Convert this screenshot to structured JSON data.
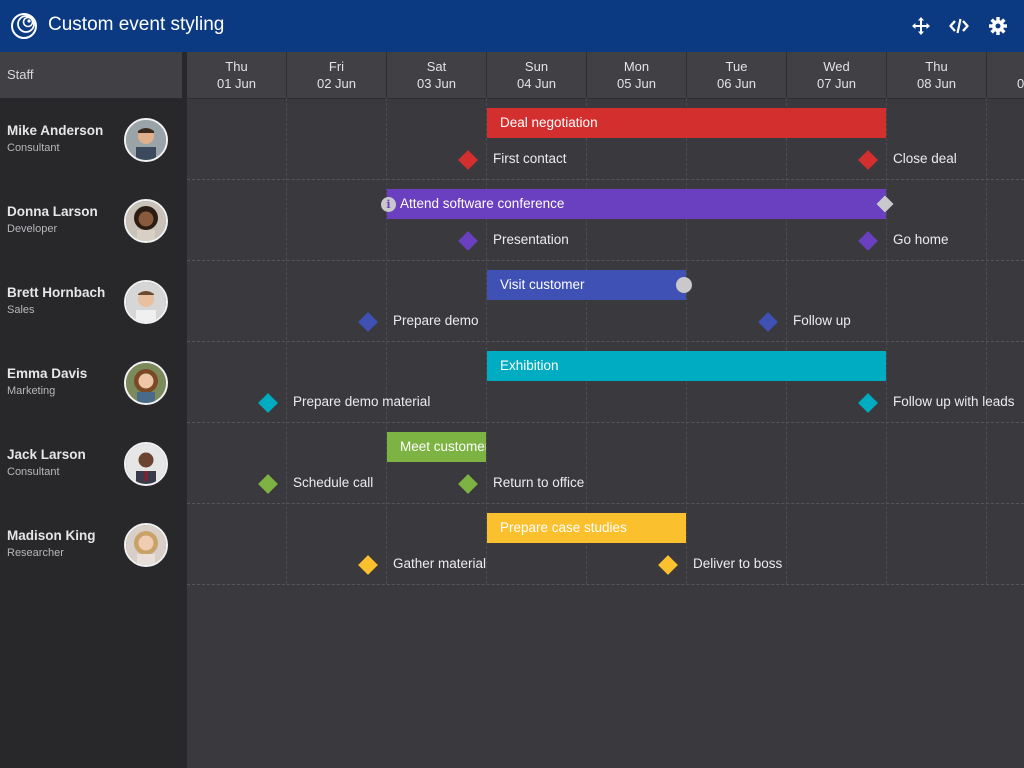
{
  "app": {
    "title": "Custom event styling"
  },
  "header_icons": [
    "move-icon",
    "code-icon",
    "gear-icon"
  ],
  "sidebar": {
    "header": "Staff"
  },
  "days": [
    {
      "name": "Thu",
      "date": "01 Jun"
    },
    {
      "name": "Fri",
      "date": "02 Jun"
    },
    {
      "name": "Sat",
      "date": "03 Jun"
    },
    {
      "name": "Sun",
      "date": "04 Jun"
    },
    {
      "name": "Mon",
      "date": "05 Jun"
    },
    {
      "name": "Tue",
      "date": "06 Jun"
    },
    {
      "name": "Wed",
      "date": "07 Jun"
    },
    {
      "name": "Thu",
      "date": "08 Jun"
    },
    {
      "name": "",
      "date": "0"
    }
  ],
  "resources": [
    {
      "name": "Mike Anderson",
      "title": "Consultant"
    },
    {
      "name": "Donna Larson",
      "title": "Developer"
    },
    {
      "name": "Brett Hornbach",
      "title": "Sales"
    },
    {
      "name": "Emma Davis",
      "title": "Marketing"
    },
    {
      "name": "Jack Larson",
      "title": "Consultant"
    },
    {
      "name": "Madison King",
      "title": "Researcher"
    }
  ],
  "events": [
    {
      "label": "Deal negotiation",
      "color": "#d32f2f"
    },
    {
      "label": "Attend software conference",
      "color": "#6a3fc0"
    },
    {
      "label": "Visit customer",
      "color": "#3f51b5"
    },
    {
      "label": "Exhibition",
      "color": "#00acc1"
    },
    {
      "label": "Meet customer",
      "color": "#7cb342"
    },
    {
      "label": "Prepare case studies",
      "color": "#fbc02d"
    }
  ],
  "milestones": [
    {
      "label": "First contact",
      "color": "#d32f2f"
    },
    {
      "label": "Close deal",
      "color": "#d32f2f"
    },
    {
      "label": "Presentation",
      "color": "#6a3fc0"
    },
    {
      "label": "Go home",
      "color": "#6a3fc0"
    },
    {
      "label": "Prepare demo",
      "color": "#3f51b5"
    },
    {
      "label": "Follow up",
      "color": "#3f51b5"
    },
    {
      "label": "Prepare demo material",
      "color": "#00acc1"
    },
    {
      "label": "Follow up with leads",
      "color": "#00acc1"
    },
    {
      "label": "Schedule call",
      "color": "#7cb342"
    },
    {
      "label": "Return to office",
      "color": "#7cb342"
    },
    {
      "label": "Gather material",
      "color": "#fbc02d"
    },
    {
      "label": "Deliver to boss",
      "color": "#fbc02d"
    }
  ],
  "info_icon": "i"
}
